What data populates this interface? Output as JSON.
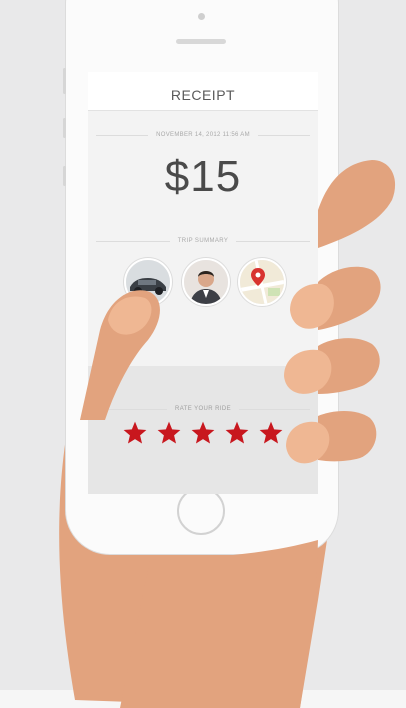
{
  "screen": {
    "title": "RECEIPT",
    "date": "NOVEMBER 14, 2012 11:56 AM",
    "amount": "$15",
    "summary_label": "TRIP SUMMARY",
    "thumbnails": [
      "car-photo",
      "driver-photo",
      "map-photo"
    ],
    "rate_label": "RATE YOUR RIDE",
    "rating": 5,
    "rating_max": 5
  },
  "colors": {
    "background": "#e9e9ea",
    "hand": "#e2a37e",
    "hand_shadow": "#d69470",
    "nail": "#efb793",
    "phone": "#fbfbfb",
    "star": "#c8171e"
  },
  "icons": [
    "star-icon",
    "car-icon",
    "driver-avatar-icon",
    "map-pin-icon"
  ]
}
